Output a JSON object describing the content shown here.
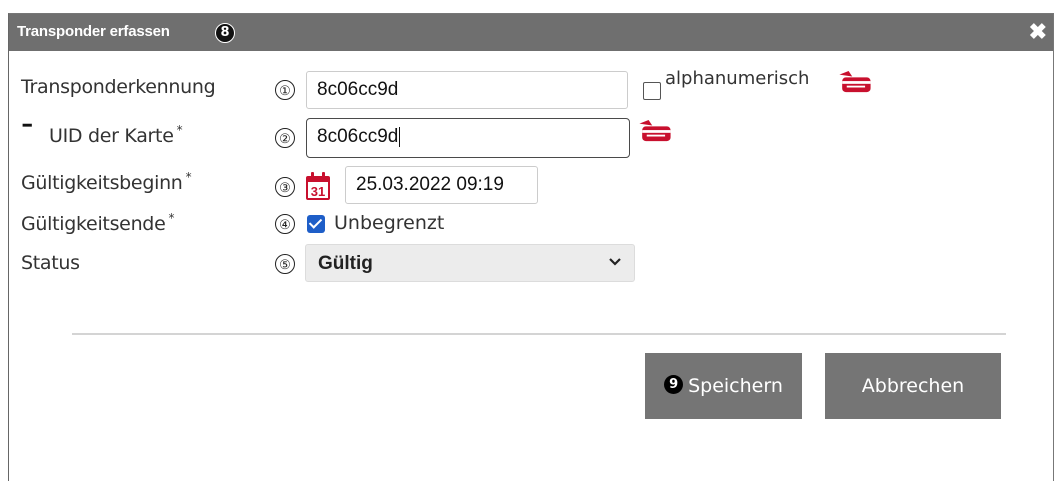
{
  "dialog": {
    "title": "Transponder erfassen",
    "title_badge": "8",
    "close_symbol": "✖"
  },
  "fields": {
    "transponder": {
      "label": "Transponderkennung",
      "number": "①",
      "value": "8c06cc9d",
      "checkbox_label": "alphanumerisch",
      "checkbox_checked": false
    },
    "uid": {
      "collapse_symbol": "━",
      "label": "UID der Karte",
      "required": "*",
      "number": "②",
      "value": "8c06cc9d"
    },
    "start": {
      "label": "Gültigkeitsbeginn",
      "required": "*",
      "number": "③",
      "value": "25.03.2022 09:19",
      "calendar_day": "31"
    },
    "end": {
      "label": "Gültigkeitsende",
      "required": "*",
      "number": "④",
      "checkbox_label": "Unbegrenzt",
      "checkbox_checked": true
    },
    "status": {
      "label": "Status",
      "number": "⑤",
      "selected": "Gültig",
      "chevron": "⌄"
    }
  },
  "buttons": {
    "save": {
      "badge": "9",
      "label": "Speichern"
    },
    "cancel": {
      "label": "Abbrechen"
    }
  },
  "colors": {
    "titlebar": "#6f6f6f",
    "button": "#757575",
    "accent": "#c8102e",
    "checkbox": "#1e5ec8"
  },
  "icons": [
    "card-reader-icon",
    "calendar-icon",
    "close-icon",
    "chevron-down-icon",
    "collapse-icon"
  ]
}
